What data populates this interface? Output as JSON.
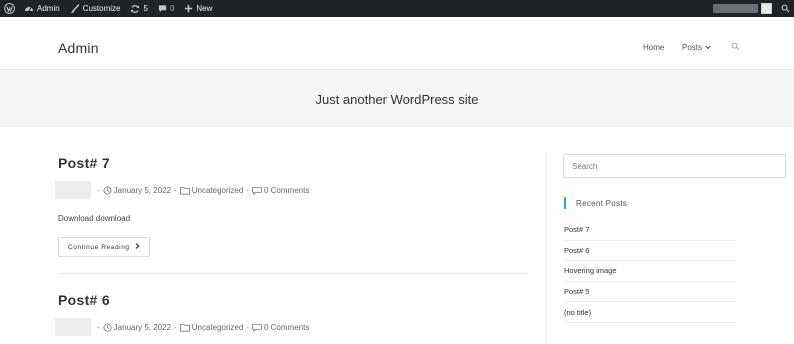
{
  "admin_bar": {
    "site_name": "Admin",
    "customize": "Customize",
    "updates_count": "5",
    "comments_count": "0",
    "new_label": "New"
  },
  "header": {
    "site_title": "Admin",
    "nav": {
      "home": "Home",
      "posts": "Posts"
    }
  },
  "title_bar": {
    "tagline": "Just another WordPress site"
  },
  "posts": [
    {
      "title": "Post# 7",
      "date": "January 5, 2022",
      "category": "Uncategorized",
      "comments": "0 Comments",
      "excerpt": "Download download",
      "read_more": "Continue Reading"
    },
    {
      "title": "Post# 6",
      "date": "January 5, 2022",
      "category": "Uncategorized",
      "comments": "0 Comments"
    }
  ],
  "sidebar": {
    "search_placeholder": "Search",
    "recent_posts_title": "Recent Posts",
    "recent_posts": [
      "Post# 7",
      "Post# 6",
      "Hovering image",
      "Post# 5",
      "(no title)"
    ]
  },
  "colors": {
    "admin_bar_bg": "#1d2327",
    "accent": "#13aff0",
    "title_bar_bg": "#f5f5f5"
  }
}
